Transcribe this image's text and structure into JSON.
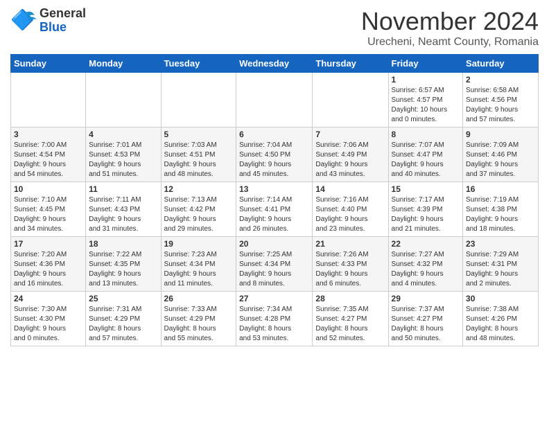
{
  "header": {
    "logo_general": "General",
    "logo_blue": "Blue",
    "month_title": "November 2024",
    "location": "Urecheni, Neamt County, Romania"
  },
  "days_of_week": [
    "Sunday",
    "Monday",
    "Tuesday",
    "Wednesday",
    "Thursday",
    "Friday",
    "Saturday"
  ],
  "weeks": [
    [
      {
        "day": "",
        "info": ""
      },
      {
        "day": "",
        "info": ""
      },
      {
        "day": "",
        "info": ""
      },
      {
        "day": "",
        "info": ""
      },
      {
        "day": "",
        "info": ""
      },
      {
        "day": "1",
        "info": "Sunrise: 6:57 AM\nSunset: 4:57 PM\nDaylight: 10 hours\nand 0 minutes."
      },
      {
        "day": "2",
        "info": "Sunrise: 6:58 AM\nSunset: 4:56 PM\nDaylight: 9 hours\nand 57 minutes."
      }
    ],
    [
      {
        "day": "3",
        "info": "Sunrise: 7:00 AM\nSunset: 4:54 PM\nDaylight: 9 hours\nand 54 minutes."
      },
      {
        "day": "4",
        "info": "Sunrise: 7:01 AM\nSunset: 4:53 PM\nDaylight: 9 hours\nand 51 minutes."
      },
      {
        "day": "5",
        "info": "Sunrise: 7:03 AM\nSunset: 4:51 PM\nDaylight: 9 hours\nand 48 minutes."
      },
      {
        "day": "6",
        "info": "Sunrise: 7:04 AM\nSunset: 4:50 PM\nDaylight: 9 hours\nand 45 minutes."
      },
      {
        "day": "7",
        "info": "Sunrise: 7:06 AM\nSunset: 4:49 PM\nDaylight: 9 hours\nand 43 minutes."
      },
      {
        "day": "8",
        "info": "Sunrise: 7:07 AM\nSunset: 4:47 PM\nDaylight: 9 hours\nand 40 minutes."
      },
      {
        "day": "9",
        "info": "Sunrise: 7:09 AM\nSunset: 4:46 PM\nDaylight: 9 hours\nand 37 minutes."
      }
    ],
    [
      {
        "day": "10",
        "info": "Sunrise: 7:10 AM\nSunset: 4:45 PM\nDaylight: 9 hours\nand 34 minutes."
      },
      {
        "day": "11",
        "info": "Sunrise: 7:11 AM\nSunset: 4:43 PM\nDaylight: 9 hours\nand 31 minutes."
      },
      {
        "day": "12",
        "info": "Sunrise: 7:13 AM\nSunset: 4:42 PM\nDaylight: 9 hours\nand 29 minutes."
      },
      {
        "day": "13",
        "info": "Sunrise: 7:14 AM\nSunset: 4:41 PM\nDaylight: 9 hours\nand 26 minutes."
      },
      {
        "day": "14",
        "info": "Sunrise: 7:16 AM\nSunset: 4:40 PM\nDaylight: 9 hours\nand 23 minutes."
      },
      {
        "day": "15",
        "info": "Sunrise: 7:17 AM\nSunset: 4:39 PM\nDaylight: 9 hours\nand 21 minutes."
      },
      {
        "day": "16",
        "info": "Sunrise: 7:19 AM\nSunset: 4:38 PM\nDaylight: 9 hours\nand 18 minutes."
      }
    ],
    [
      {
        "day": "17",
        "info": "Sunrise: 7:20 AM\nSunset: 4:36 PM\nDaylight: 9 hours\nand 16 minutes."
      },
      {
        "day": "18",
        "info": "Sunrise: 7:22 AM\nSunset: 4:35 PM\nDaylight: 9 hours\nand 13 minutes."
      },
      {
        "day": "19",
        "info": "Sunrise: 7:23 AM\nSunset: 4:34 PM\nDaylight: 9 hours\nand 11 minutes."
      },
      {
        "day": "20",
        "info": "Sunrise: 7:25 AM\nSunset: 4:34 PM\nDaylight: 9 hours\nand 8 minutes."
      },
      {
        "day": "21",
        "info": "Sunrise: 7:26 AM\nSunset: 4:33 PM\nDaylight: 9 hours\nand 6 minutes."
      },
      {
        "day": "22",
        "info": "Sunrise: 7:27 AM\nSunset: 4:32 PM\nDaylight: 9 hours\nand 4 minutes."
      },
      {
        "day": "23",
        "info": "Sunrise: 7:29 AM\nSunset: 4:31 PM\nDaylight: 9 hours\nand 2 minutes."
      }
    ],
    [
      {
        "day": "24",
        "info": "Sunrise: 7:30 AM\nSunset: 4:30 PM\nDaylight: 9 hours\nand 0 minutes."
      },
      {
        "day": "25",
        "info": "Sunrise: 7:31 AM\nSunset: 4:29 PM\nDaylight: 8 hours\nand 57 minutes."
      },
      {
        "day": "26",
        "info": "Sunrise: 7:33 AM\nSunset: 4:29 PM\nDaylight: 8 hours\nand 55 minutes."
      },
      {
        "day": "27",
        "info": "Sunrise: 7:34 AM\nSunset: 4:28 PM\nDaylight: 8 hours\nand 53 minutes."
      },
      {
        "day": "28",
        "info": "Sunrise: 7:35 AM\nSunset: 4:27 PM\nDaylight: 8 hours\nand 52 minutes."
      },
      {
        "day": "29",
        "info": "Sunrise: 7:37 AM\nSunset: 4:27 PM\nDaylight: 8 hours\nand 50 minutes."
      },
      {
        "day": "30",
        "info": "Sunrise: 7:38 AM\nSunset: 4:26 PM\nDaylight: 8 hours\nand 48 minutes."
      }
    ]
  ]
}
